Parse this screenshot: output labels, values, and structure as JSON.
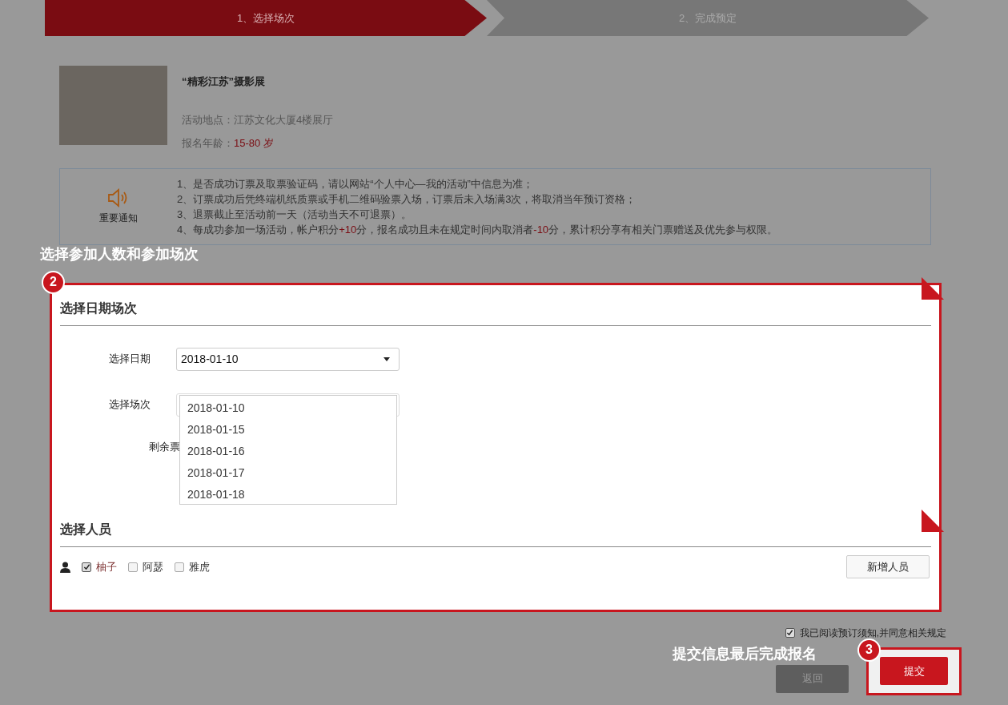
{
  "steps": [
    {
      "label": "1、选择场次",
      "selected": true
    },
    {
      "label": "2、完成预定",
      "selected": false
    }
  ],
  "event": {
    "title": "“精彩江苏”摄影展",
    "location_label": "活动地点：",
    "location": "江苏文化大厦4楼展厅",
    "age_label": "报名年龄：",
    "age": "15-80 岁"
  },
  "notice": {
    "label": "重要通知",
    "items": [
      [
        {
          "text": "1、是否成功订票及取票验证码，请以网站“个人中心—我的活动”中信息为准；",
          "highlight": false
        }
      ],
      [
        {
          "text": "2、订票成功后凭终端机纸质票或手机二维码验票入场，订票后未入场满3次，将取消当年预订资格；",
          "highlight": false
        }
      ],
      [
        {
          "text": "3、退票截止至活动前一天（活动当天不可退票）。",
          "highlight": false
        }
      ],
      [
        {
          "text": "4、每成功参加一场活动，帐户积分",
          "highlight": false
        },
        {
          "text": "+10",
          "highlight": true
        },
        {
          "text": "分，报名成功且未在规定时间内取消者",
          "highlight": false
        },
        {
          "text": "-10",
          "highlight": true
        },
        {
          "text": "分，累计积分享有相关门票赠送及优先参与权限。",
          "highlight": false
        }
      ]
    ]
  },
  "callout_top": {
    "caption": "选择参加人数和参加场次",
    "badge": "2"
  },
  "date_section": {
    "title": "选择日期场次",
    "date_label": "选择日期",
    "date_value": "2018-01-10",
    "expanded": true,
    "options": [
      "2018-01-10",
      "2018-01-15",
      "2018-01-16",
      "2018-01-17",
      "2018-01-18"
    ],
    "session_label": "选择场次",
    "tickets_label": "剩余票"
  },
  "people_section": {
    "title": "选择人员",
    "people": [
      {
        "name": "柚子",
        "checked": true
      },
      {
        "name": "阿瑟",
        "checked": false
      },
      {
        "name": "雅虎",
        "checked": false
      }
    ],
    "add_button": "新增人员"
  },
  "agreement": {
    "label": "我已阅读预订须知,并同意相关规定",
    "checked": true
  },
  "callout_bottom": {
    "caption": "提交信息最后完成报名",
    "badge": "3"
  },
  "buttons": {
    "back": "返回",
    "submit": "提交"
  }
}
